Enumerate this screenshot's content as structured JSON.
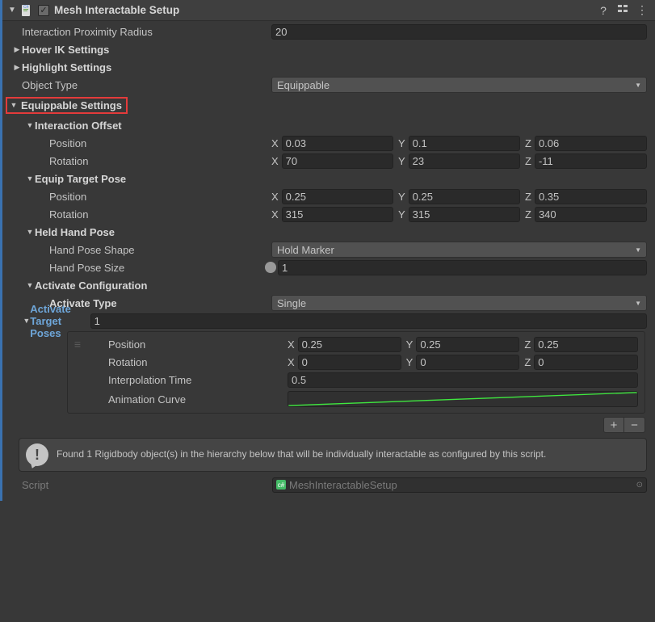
{
  "header": {
    "title": "Mesh Interactable Setup",
    "checked": true
  },
  "proximity": {
    "label": "Interaction Proximity Radius",
    "value": "20"
  },
  "hoverIK": {
    "label": "Hover IK Settings"
  },
  "highlight": {
    "label": "Highlight Settings"
  },
  "objectType": {
    "label": "Object Type",
    "value": "Equippable"
  },
  "equipSettings": {
    "label": "Equippable Settings",
    "interactionOffset": {
      "label": "Interaction Offset",
      "position": {
        "label": "Position",
        "x": "0.03",
        "y": "0.1",
        "z": "0.06"
      },
      "rotation": {
        "label": "Rotation",
        "x": "70",
        "y": "23",
        "z": "-11"
      }
    },
    "equipTargetPose": {
      "label": "Equip Target Pose",
      "position": {
        "label": "Position",
        "x": "0.25",
        "y": "0.25",
        "z": "0.35"
      },
      "rotation": {
        "label": "Rotation",
        "x": "315",
        "y": "315",
        "z": "340"
      }
    },
    "heldHandPose": {
      "label": "Held Hand Pose",
      "shape": {
        "label": "Hand Pose Shape",
        "value": "Hold Marker"
      },
      "size": {
        "label": "Hand Pose Size",
        "value": "1"
      }
    },
    "activateConfig": {
      "label": "Activate Configuration",
      "type": {
        "label": "Activate Type",
        "value": "Single"
      },
      "targetPoses": {
        "label": "Activate Target Poses",
        "count": "1",
        "item0": {
          "position": {
            "label": "Position",
            "x": "0.25",
            "y": "0.25",
            "z": "0.25"
          },
          "rotation": {
            "label": "Rotation",
            "x": "0",
            "y": "0",
            "z": "0"
          },
          "interp": {
            "label": "Interpolation Time",
            "value": "0.5"
          },
          "curve": {
            "label": "Animation Curve"
          }
        }
      }
    }
  },
  "info": {
    "message": "Found 1 Rigidbody object(s) in the hierarchy below that will be individually interactable as configured by this script."
  },
  "script": {
    "label": "Script",
    "value": "MeshInteractableSetup"
  },
  "axis": {
    "x": "X",
    "y": "Y",
    "z": "Z"
  },
  "buttons": {
    "plus": "+",
    "minus": "−"
  }
}
